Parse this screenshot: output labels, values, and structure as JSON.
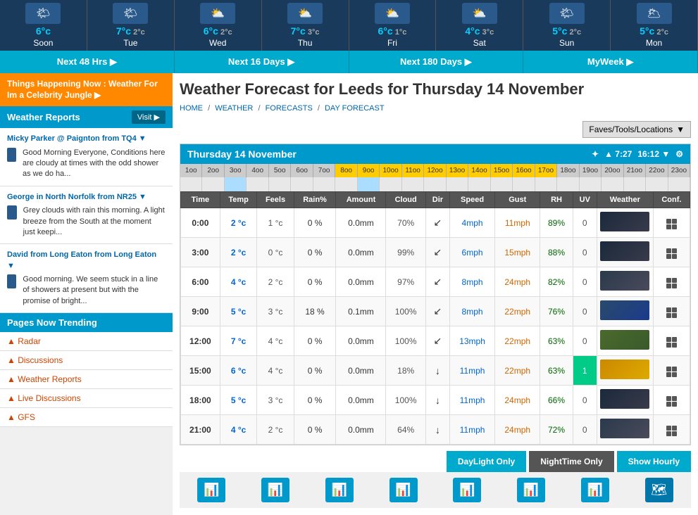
{
  "topBar": {
    "cells": [
      {
        "icon": "🌤",
        "tempMain": "6°c",
        "tempSub": "",
        "day": "Soon",
        "bg": "#1a3a5c"
      },
      {
        "icon": "🌤",
        "tempMain": "7°c",
        "tempSub": "2°c",
        "day": "Tue",
        "bg": "#1a3a5c"
      },
      {
        "icon": "⛅",
        "tempMain": "6°c",
        "tempSub": "2°c",
        "day": "Wed",
        "bg": "#1a3a5c"
      },
      {
        "icon": "⛅",
        "tempMain": "7°c",
        "tempSub": "3°c",
        "day": "Thu",
        "bg": "#1a3a5c"
      },
      {
        "icon": "⛅",
        "tempMain": "6°c",
        "tempSub": "1°c",
        "day": "Fri",
        "bg": "#1a3a5c"
      },
      {
        "icon": "⛅",
        "tempMain": "4°c",
        "tempSub": "3°c",
        "day": "Sat",
        "bg": "#1a3a5c"
      },
      {
        "icon": "🌤",
        "tempMain": "5°c",
        "tempSub": "2°c",
        "day": "Sun",
        "bg": "#1a3a5c"
      },
      {
        "icon": "🌥",
        "tempMain": "5°c",
        "tempSub": "2°c",
        "day": "Mon",
        "bg": "#1a3a5c"
      }
    ]
  },
  "navTabs": [
    {
      "label": "Next 48 Hrs ▶",
      "key": "48hrs"
    },
    {
      "label": "Next 16 Days ▶",
      "key": "16days"
    },
    {
      "label": "Next 180 Days ▶",
      "key": "180days"
    },
    {
      "label": "MyWeek ▶",
      "key": "myweek"
    }
  ],
  "sidebar": {
    "banner": "Things Happening Now : Weather For Im a Celebrity Jungle ▶",
    "reportsHeader": "Weather Reports",
    "visitBtn": "Visit ▶",
    "reports": [
      {
        "name": "Micky Parker @ Paignton from TQ4 ▼",
        "text": "Good Morning Everyone, Conditions here are cloudy at times with the odd shower as we do ha..."
      },
      {
        "name": "George in North Norfolk from NR25 ▼",
        "text": "Grey clouds with rain this morning. A light breeze from the South at the moment just keepi..."
      },
      {
        "name": "David from Long Eaton from Long Eaton ▼",
        "text": "Good morning. We seem stuck in a line of showers at present but with the promise of bright..."
      }
    ],
    "trendingHeader": "Pages Now Trending",
    "trendingItems": [
      "Radar",
      "Discussions",
      "Weather Reports",
      "Live Discussions",
      "GFS"
    ]
  },
  "content": {
    "title": "Weather Forecast for Leeds for Thursday 14 November",
    "breadcrumb": [
      "HOME",
      "WEATHER",
      "FORECASTS",
      "DAY FORECAST"
    ],
    "favesLabel": "Faves/Tools/Locations",
    "forecastDate": "Thursday 14 November",
    "sunriseLabel": "▲ 7:27",
    "sunsetLabel": "16:12 ▼",
    "tableHeaders": [
      "Time",
      "Temp",
      "Feels",
      "Rain%",
      "Amount",
      "Cloud",
      "Dir",
      "Speed",
      "Gust",
      "RH",
      "UV",
      "Weather",
      "Conf."
    ],
    "hours": [
      "1oo",
      "2oo",
      "3oo",
      "4oo",
      "5oo",
      "6oo",
      "7oo",
      "8oo",
      "9oo",
      "10oo",
      "11oo",
      "12oo",
      "13oo",
      "14oo",
      "15oo",
      "16oo",
      "17oo",
      "18oo",
      "19oo",
      "20oo",
      "21oo",
      "22oo",
      "23oo"
    ],
    "rows": [
      {
        "time": "0:00",
        "temp": "2 °c",
        "feels": "1 °c",
        "rain": "0 %",
        "amount": "0.0mm",
        "cloud": "70%",
        "dir": "↙",
        "speed": "4mph",
        "gust": "11mph",
        "rh": "89%",
        "uv": "0",
        "weatherClass": "night-cloud",
        "conf": "grid"
      },
      {
        "time": "3:00",
        "temp": "2 °c",
        "feels": "0 °c",
        "rain": "0 %",
        "amount": "0.0mm",
        "cloud": "99%",
        "dir": "↙",
        "speed": "6mph",
        "gust": "15mph",
        "rh": "88%",
        "uv": "0",
        "weatherClass": "night-cloud",
        "conf": "grid"
      },
      {
        "time": "6:00",
        "temp": "4 °c",
        "feels": "2 °c",
        "rain": "0 %",
        "amount": "0.0mm",
        "cloud": "97%",
        "dir": "↙",
        "speed": "8mph",
        "gust": "24mph",
        "rh": "82%",
        "uv": "0",
        "weatherClass": "cloudy",
        "conf": "grid"
      },
      {
        "time": "9:00",
        "temp": "5 °c",
        "feels": "3 °c",
        "rain": "18 %",
        "amount": "0.1mm",
        "cloud": "100%",
        "dir": "↙",
        "speed": "8mph",
        "gust": "22mph",
        "rh": "76%",
        "uv": "0",
        "weatherClass": "rain",
        "conf": "grid",
        "highlight": true
      },
      {
        "time": "12:00",
        "temp": "7 °c",
        "feels": "4 °c",
        "rain": "0 %",
        "amount": "0.0mm",
        "cloud": "100%",
        "dir": "↙",
        "speed": "13mph",
        "gust": "22mph",
        "rh": "63%",
        "uv": "0",
        "weatherClass": "sun-cloud",
        "conf": "grid"
      },
      {
        "time": "15:00",
        "temp": "6 °c",
        "feels": "4 °c",
        "rain": "0 %",
        "amount": "0.0mm",
        "cloud": "18%",
        "dir": "↓",
        "speed": "11mph",
        "gust": "22mph",
        "rh": "63%",
        "uv": "1",
        "weatherClass": "yellow",
        "conf": "grid",
        "uvHighlight": true
      },
      {
        "time": "18:00",
        "temp": "5 °c",
        "feels": "3 °c",
        "rain": "0 %",
        "amount": "0.0mm",
        "cloud": "100%",
        "dir": "↓",
        "speed": "11mph",
        "gust": "24mph",
        "rh": "66%",
        "uv": "0",
        "weatherClass": "night-cloud",
        "conf": "grid"
      },
      {
        "time": "21:00",
        "temp": "4 °c",
        "feels": "2 °c",
        "rain": "0 %",
        "amount": "0.0mm",
        "cloud": "64%",
        "dir": "↓",
        "speed": "11mph",
        "gust": "24mph",
        "rh": "72%",
        "uv": "0",
        "weatherClass": "cloudy",
        "conf": "grid"
      }
    ],
    "bottomButtons": {
      "daylightOnly": "DayLight Only",
      "nightTime": "NightTime Only",
      "showHourly": "Show Hourly"
    },
    "chartIcons": [
      "📊",
      "📊",
      "📊",
      "📊",
      "📊",
      "📊",
      "📊",
      "🗺"
    ]
  }
}
